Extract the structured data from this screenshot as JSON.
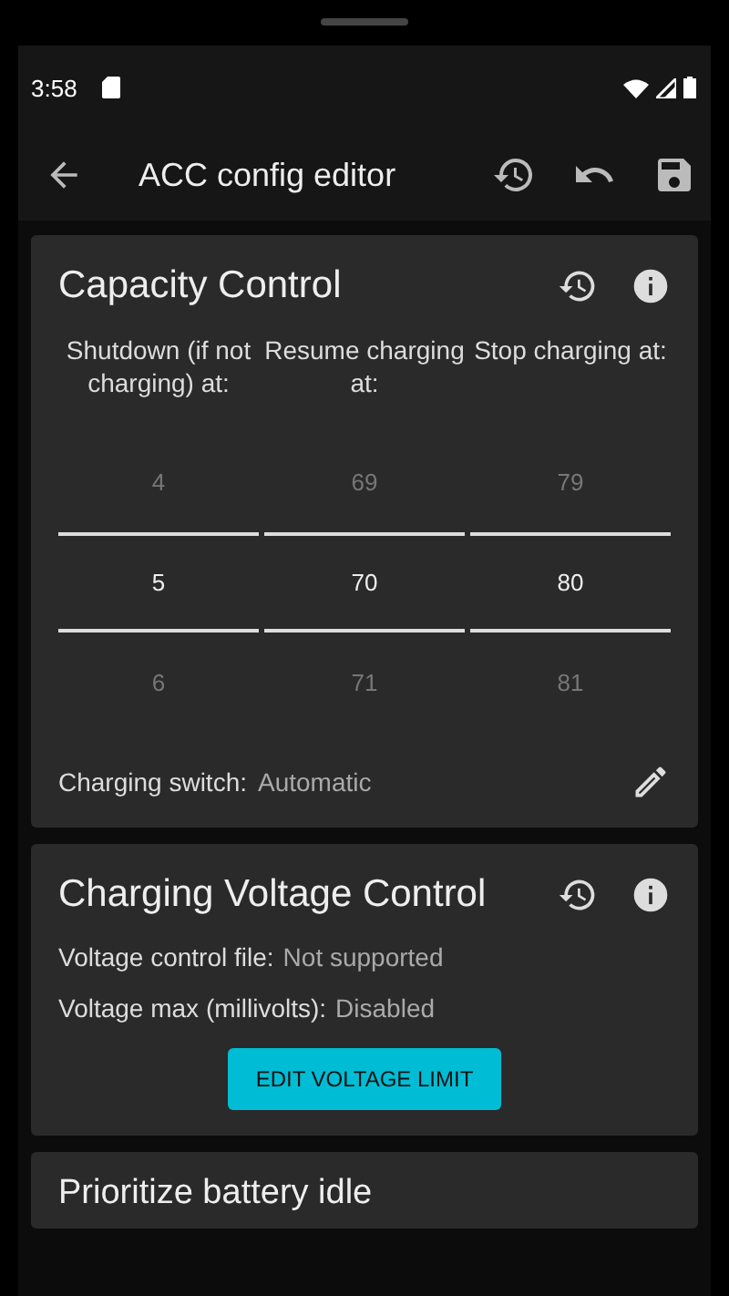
{
  "status_bar": {
    "time": "3:58"
  },
  "toolbar": {
    "title": "ACC config editor"
  },
  "capacity": {
    "title": "Capacity Control",
    "pickers": [
      {
        "header": "Shutdown (if not charging) at:",
        "values": [
          {
            "text": "4",
            "selected": false
          },
          {
            "text": "5",
            "selected": true
          },
          {
            "text": "6",
            "selected": false
          }
        ]
      },
      {
        "header": "Resume charging at:",
        "values": [
          {
            "text": "69",
            "selected": false
          },
          {
            "text": "70",
            "selected": true
          },
          {
            "text": "71",
            "selected": false
          }
        ]
      },
      {
        "header": "Stop charging at:",
        "values": [
          {
            "text": "79",
            "selected": false
          },
          {
            "text": "80",
            "selected": true
          },
          {
            "text": "81",
            "selected": false
          }
        ]
      }
    ],
    "switch_label": "Charging switch:",
    "switch_value": "Automatic"
  },
  "voltage": {
    "title": "Charging Voltage Control",
    "rows": [
      {
        "label": "Voltage control file:",
        "value": "Not supported"
      },
      {
        "label": "Voltage max (millivolts):",
        "value": "Disabled"
      }
    ],
    "button": "EDIT VOLTAGE LIMIT"
  },
  "next_card": {
    "title": "Prioritize battery idle"
  }
}
